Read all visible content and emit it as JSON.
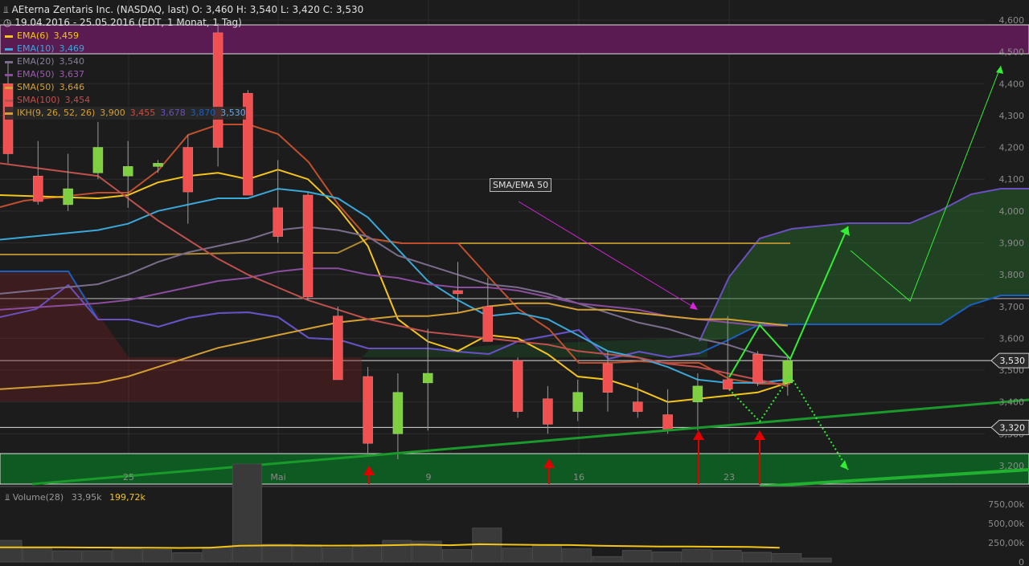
{
  "header": {
    "title": "AEterna Zentaris Inc. (NASDAQ, last)  O: 3,460  H: 3,540  L: 3,420  C: 3,530",
    "period": "19.04.2016 - 25.05.2016 (EDT, 1 Monat, 1 Tag)"
  },
  "legend": [
    {
      "name": "EMA(6)",
      "value": "3,459",
      "color": "#f5c518"
    },
    {
      "name": "EMA(10)",
      "value": "3,469",
      "color": "#3aa8d8"
    },
    {
      "name": "EMA(20)",
      "value": "3,540",
      "color": "#7a6d8c"
    },
    {
      "name": "EMA(50)",
      "value": "3,637",
      "color": "#8b4d9e"
    },
    {
      "name": "SMA(50)",
      "value": "3,646",
      "color": "#d4a033"
    },
    {
      "name": "SMA(100)",
      "value": "3,454",
      "color": "#c0504d"
    }
  ],
  "ikh": {
    "name": "IKH(9, 26, 52, 26)",
    "values": [
      "3,900",
      "3,455",
      "3,678",
      "3,870",
      "3,530"
    ],
    "colors": [
      "#d4a033",
      "#c0504d",
      "#6a4fc0",
      "#1a60c0",
      "#6aa8e0"
    ]
  },
  "annotation": "SMA/EMA 50",
  "price_badges": [
    "3,530",
    "3,320"
  ],
  "volume": {
    "label": "Volume(28)",
    "value1": "33,95k",
    "value2": "199,72k"
  },
  "colors": {
    "up": "#7ed040",
    "down": "#f05050",
    "bg": "#1c1c1c",
    "grid": "#2e2e2e"
  },
  "chart_data": {
    "type": "candlestick",
    "title": "AEterna Zentaris Inc. (NASDAQ, last)",
    "ylim": [
      3.15,
      4.62
    ],
    "yticks": [
      "4,600",
      "4,500",
      "4,400",
      "4,300",
      "4,200",
      "4,100",
      "4,000",
      "3,900",
      "3,800",
      "3,700",
      "3,600",
      "3,500",
      "3,400",
      "3,300",
      "3,200"
    ],
    "xticks": [
      "25",
      "Mai",
      "9",
      "16",
      "23"
    ],
    "candles": [
      {
        "d": "19.04",
        "o": 4.4,
        "h": 4.47,
        "l": 4.15,
        "c": 4.18
      },
      {
        "d": "20.04",
        "o": 4.11,
        "h": 4.22,
        "l": 4.02,
        "c": 4.03
      },
      {
        "d": "21.04",
        "o": 4.02,
        "h": 4.18,
        "l": 4.0,
        "c": 4.07
      },
      {
        "d": "22.04",
        "o": 4.12,
        "h": 4.28,
        "l": 4.1,
        "c": 4.2
      },
      {
        "d": "25.04",
        "o": 4.11,
        "h": 4.22,
        "l": 4.01,
        "c": 4.14
      },
      {
        "d": "26.04",
        "o": 4.14,
        "h": 4.16,
        "l": 4.12,
        "c": 4.15
      },
      {
        "d": "27.04",
        "o": 4.2,
        "h": 4.24,
        "l": 3.96,
        "c": 4.06
      },
      {
        "d": "28.04",
        "o": 4.56,
        "h": 4.59,
        "l": 4.14,
        "c": 4.2
      },
      {
        "d": "29.04",
        "o": 4.37,
        "h": 4.38,
        "l": 4.05,
        "c": 4.05
      },
      {
        "d": "02.05",
        "o": 4.01,
        "h": 4.16,
        "l": 3.9,
        "c": 3.92
      },
      {
        "d": "03.05",
        "o": 4.05,
        "h": 4.06,
        "l": 3.72,
        "c": 3.73
      },
      {
        "d": "04.05",
        "o": 3.67,
        "h": 3.7,
        "l": 3.47,
        "c": 3.47
      },
      {
        "d": "05.05",
        "o": 3.48,
        "h": 3.51,
        "l": 3.24,
        "c": 3.27
      },
      {
        "d": "06.05",
        "o": 3.3,
        "h": 3.49,
        "l": 3.22,
        "c": 3.43
      },
      {
        "d": "09.05",
        "o": 3.46,
        "h": 3.63,
        "l": 3.31,
        "c": 3.49
      },
      {
        "d": "10.05",
        "o": 3.75,
        "h": 3.84,
        "l": 3.68,
        "c": 3.74
      },
      {
        "d": "11.05",
        "o": 3.7,
        "h": 3.79,
        "l": 3.59,
        "c": 3.59
      },
      {
        "d": "12.05",
        "o": 3.53,
        "h": 3.54,
        "l": 3.35,
        "c": 3.37
      },
      {
        "d": "13.05",
        "o": 3.41,
        "h": 3.45,
        "l": 3.3,
        "c": 3.33
      },
      {
        "d": "16.05",
        "o": 3.37,
        "h": 3.47,
        "l": 3.34,
        "c": 3.43
      },
      {
        "d": "17.05",
        "o": 3.52,
        "h": 3.56,
        "l": 3.37,
        "c": 3.43
      },
      {
        "d": "18.05",
        "o": 3.4,
        "h": 3.46,
        "l": 3.35,
        "c": 3.37
      },
      {
        "d": "19.05",
        "o": 3.36,
        "h": 3.44,
        "l": 3.3,
        "c": 3.31
      },
      {
        "d": "20.05",
        "o": 3.4,
        "h": 3.49,
        "l": 3.31,
        "c": 3.45
      },
      {
        "d": "23.05",
        "o": 3.47,
        "h": 3.67,
        "l": 3.44,
        "c": 3.44
      },
      {
        "d": "24.05",
        "o": 3.55,
        "h": 3.56,
        "l": 3.45,
        "c": 3.46
      },
      {
        "d": "25.05",
        "o": 3.46,
        "h": 3.54,
        "l": 3.42,
        "c": 3.53
      }
    ],
    "series": [
      {
        "name": "EMA(6)",
        "values": [
          4.05,
          4.04,
          4.05,
          4.09,
          4.11,
          4.12,
          4.1,
          4.13,
          4.1,
          4.01,
          3.89,
          3.66,
          3.59,
          3.56,
          3.61,
          3.6,
          3.55,
          3.48,
          3.47,
          3.44,
          3.4,
          3.41,
          3.42,
          3.43,
          3.46
        ]
      },
      {
        "name": "EMA(10)",
        "values": [
          3.91,
          3.94,
          3.96,
          4.0,
          4.02,
          4.04,
          4.04,
          4.07,
          4.06,
          4.04,
          3.98,
          3.88,
          3.78,
          3.72,
          3.67,
          3.68,
          3.66,
          3.61,
          3.56,
          3.54,
          3.51,
          3.47,
          3.46,
          3.46,
          3.47
        ]
      },
      {
        "name": "EMA(20)",
        "values": [
          3.74,
          3.77,
          3.8,
          3.84,
          3.87,
          3.89,
          3.91,
          3.94,
          3.95,
          3.94,
          3.92,
          3.86,
          3.83,
          3.8,
          3.77,
          3.76,
          3.74,
          3.71,
          3.68,
          3.65,
          3.63,
          3.6,
          3.58,
          3.55,
          3.54
        ]
      },
      {
        "name": "EMA(50)",
        "values": [
          3.69,
          3.71,
          3.72,
          3.74,
          3.76,
          3.78,
          3.79,
          3.81,
          3.82,
          3.82,
          3.8,
          3.79,
          3.77,
          3.76,
          3.76,
          3.75,
          3.73,
          3.71,
          3.7,
          3.69,
          3.67,
          3.66,
          3.65,
          3.64,
          3.64
        ]
      },
      {
        "name": "SMA(50)",
        "values": [
          3.44,
          3.46,
          3.48,
          3.51,
          3.54,
          3.57,
          3.59,
          3.61,
          3.63,
          3.65,
          3.66,
          3.67,
          3.67,
          3.68,
          3.7,
          3.71,
          3.71,
          3.69,
          3.69,
          3.68,
          3.67,
          3.66,
          3.66,
          3.65,
          3.64
        ]
      },
      {
        "name": "SMA(100)",
        "values": [
          4.15,
          4.11,
          4.04,
          3.97,
          3.91,
          3.85,
          3.8,
          3.76,
          3.72,
          3.69,
          3.66,
          3.64,
          3.62,
          3.61,
          3.6,
          3.59,
          3.58,
          3.56,
          3.55,
          3.54,
          3.52,
          3.51,
          3.49,
          3.47,
          3.45
        ]
      }
    ],
    "volume": [
      280000,
      180000,
      145000,
      145000,
      170000,
      160000,
      120000,
      190000,
      1270000,
      230000,
      220000,
      185000,
      220000,
      280000,
      270000,
      160000,
      440000,
      180000,
      215000,
      170000,
      70000,
      150000,
      130000,
      165000,
      150000,
      125000,
      110000,
      50000
    ],
    "volume_avg": 199720,
    "volume_yticks": [
      "750,00k",
      "500,00k",
      "250,00k",
      "0"
    ]
  }
}
